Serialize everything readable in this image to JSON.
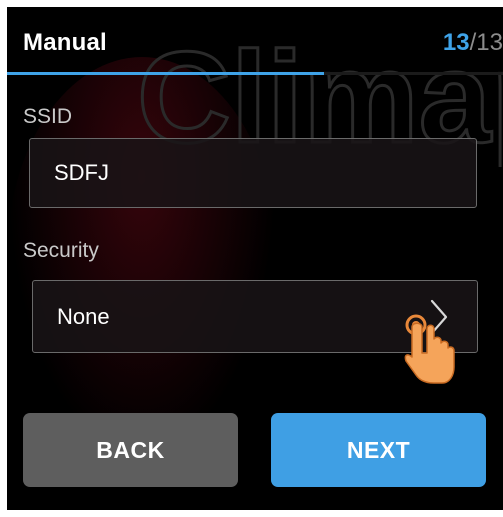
{
  "header": {
    "title": "Manual",
    "page_current": "13",
    "page_total": "/13",
    "progress": 0.64
  },
  "watermark": {
    "text": "Climap"
  },
  "ssid": {
    "label": "SSID",
    "value": "SDFJ"
  },
  "security": {
    "label": "Security",
    "value": "None",
    "icon": "chevron-right-icon"
  },
  "buttons": {
    "back_label": "BACK",
    "next_label": "NEXT"
  },
  "colors": {
    "accent": "#3fa3e8",
    "background": "#000000",
    "back_button": "#5e5e5e",
    "next_button": "#3f9fe4"
  }
}
